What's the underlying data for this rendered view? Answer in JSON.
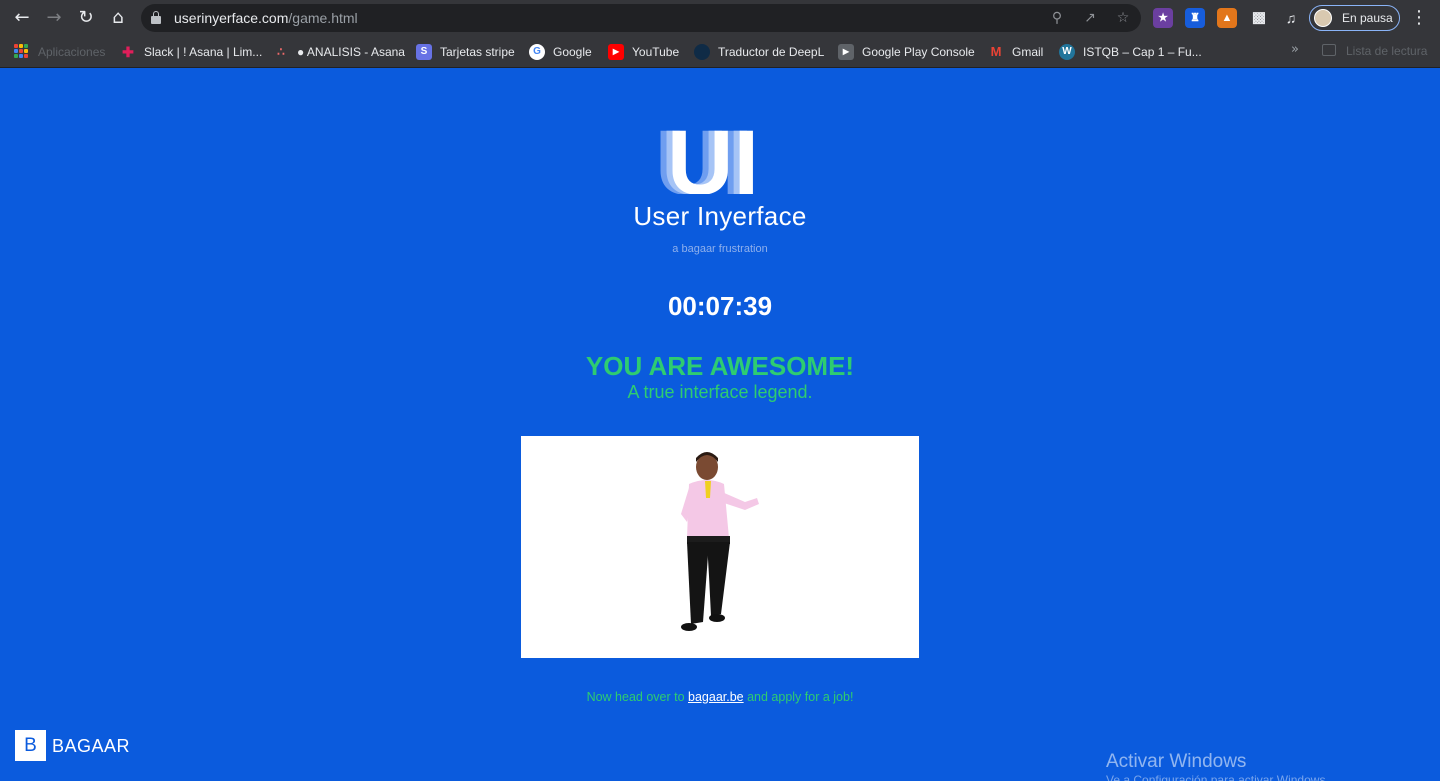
{
  "browser": {
    "url_host": "userinyerface.com",
    "url_path": "/game.html",
    "profile_label": "En pausa",
    "extensions": [
      "wizard-extension-icon",
      "bitwarden-icon",
      "metamask-icon",
      "puzzle-extensions-icon",
      "media-queue-icon"
    ]
  },
  "bookmarks": {
    "items": [
      {
        "label": "Aplicaciones"
      },
      {
        "label": "Slack | ! Asana | Lim..."
      },
      {
        "label": "● ANALISIS - Asana"
      },
      {
        "label": "Tarjetas stripe"
      },
      {
        "label": "Google"
      },
      {
        "label": "YouTube"
      },
      {
        "label": "Traductor de DeepL"
      },
      {
        "label": "Google Play Console"
      },
      {
        "label": "Gmail"
      },
      {
        "label": "ISTQB – Cap 1 – Fu..."
      }
    ],
    "more": "»",
    "reading_list": "Lista de lectura"
  },
  "page": {
    "logo_text": "UI",
    "brand": "User Inyerface",
    "tagline": "a bagaar frustration",
    "timer": "00:07:39",
    "headline": "YOU ARE AWESOME!",
    "subheadline": "A true interface legend.",
    "cta_before": "Now head over to ",
    "cta_link": "bagaar.be",
    "cta_after": " and apply for a job!",
    "footer_logo_letter": "B",
    "footer_brand": "BAGAAR"
  },
  "os": {
    "watermark": "Activar Windows",
    "watermark_sub": "Ve a Configuración para activar Windows."
  },
  "colors": {
    "page_bg": "#0b5bdd",
    "accent_green": "#2ecc71",
    "chrome_bg": "#35363a"
  }
}
